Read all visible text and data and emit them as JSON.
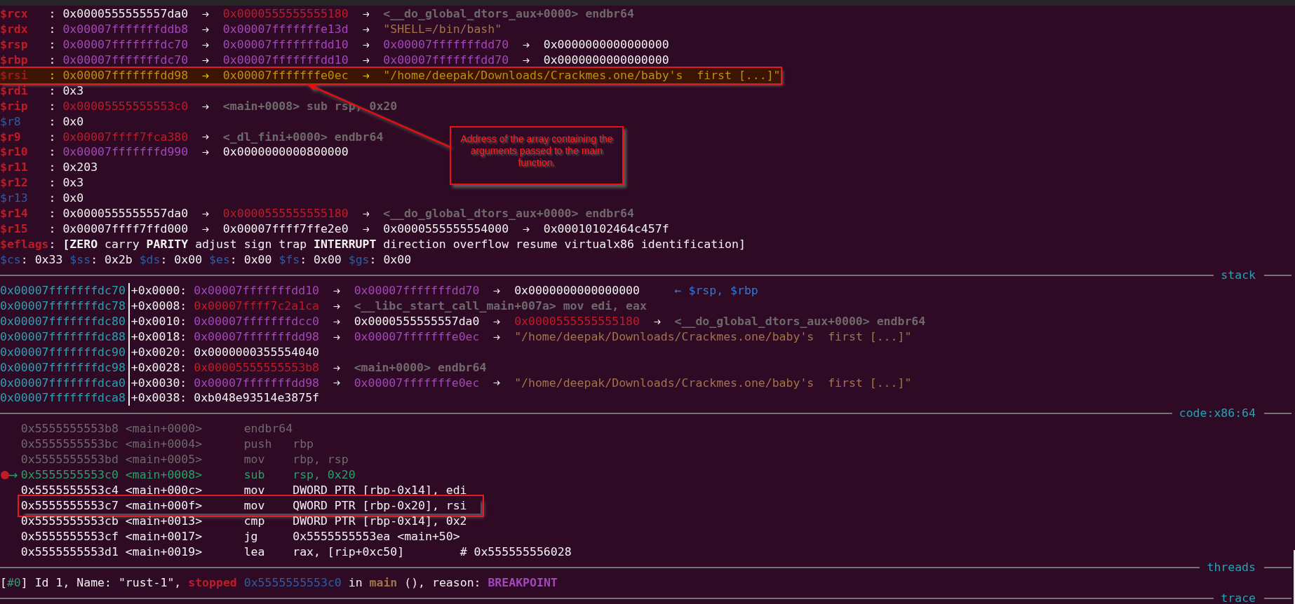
{
  "registers": [
    {
      "name": "$rcx",
      "sep": ":",
      "changed": true,
      "highlighted": false,
      "chain": [
        {
          "text": "0x0000555555557da0",
          "kind": "value"
        },
        {
          "text": "0x0000555555555180",
          "kind": "code"
        },
        {
          "text": "<__do_global_dtors_aux+0000> endbr64",
          "kind": "symbol"
        }
      ]
    },
    {
      "name": "$rdx",
      "sep": ":",
      "changed": true,
      "highlighted": false,
      "chain": [
        {
          "text": "0x00007fffffffddb8",
          "kind": "stack"
        },
        {
          "text": "0x00007fffffffe13d",
          "kind": "stack"
        },
        {
          "text": "\"SHELL=/bin/bash\"",
          "kind": "string"
        }
      ]
    },
    {
      "name": "$rsp",
      "sep": ":",
      "changed": true,
      "highlighted": false,
      "chain": [
        {
          "text": "0x00007fffffffdc70",
          "kind": "stack"
        },
        {
          "text": "0x00007fffffffdd10",
          "kind": "stack"
        },
        {
          "text": "0x00007fffffffdd70",
          "kind": "stack"
        },
        {
          "text": "0x0000000000000000",
          "kind": "value"
        }
      ]
    },
    {
      "name": "$rbp",
      "sep": ":",
      "changed": true,
      "highlighted": false,
      "chain": [
        {
          "text": "0x00007fffffffdc70",
          "kind": "stack"
        },
        {
          "text": "0x00007fffffffdd10",
          "kind": "stack"
        },
        {
          "text": "0x00007fffffffdd70",
          "kind": "stack"
        },
        {
          "text": "0x0000000000000000",
          "kind": "value"
        }
      ]
    },
    {
      "name": "$rsi",
      "sep": ":",
      "changed": true,
      "highlighted": true,
      "chain": [
        {
          "text": "0x00007fffffffdd98",
          "kind": "stack"
        },
        {
          "text": "0x00007fffffffe0ec",
          "kind": "stack"
        },
        {
          "text": "\"/home/deepak/Downloads/Crackmes.one/baby's  first [...]\"",
          "kind": "string"
        }
      ]
    },
    {
      "name": "$rdi",
      "sep": ":",
      "changed": true,
      "highlighted": false,
      "chain": [
        {
          "text": "0x3",
          "kind": "value"
        }
      ]
    },
    {
      "name": "$rip",
      "sep": ":",
      "changed": true,
      "highlighted": false,
      "chain": [
        {
          "text": "0x00005555555553c0",
          "kind": "code"
        },
        {
          "text": "<main+0008> sub rsp, 0x20",
          "kind": "symbol"
        }
      ]
    },
    {
      "name": "$r8",
      "sep": ":",
      "changed": false,
      "highlighted": false,
      "chain": [
        {
          "text": "0x0",
          "kind": "value"
        }
      ]
    },
    {
      "name": "$r9",
      "sep": ":",
      "changed": true,
      "highlighted": false,
      "chain": [
        {
          "text": "0x00007ffff7fca380",
          "kind": "code"
        },
        {
          "text": "<_dl_fini+0000> endbr64",
          "kind": "symbol"
        }
      ]
    },
    {
      "name": "$r10",
      "sep": ":",
      "changed": true,
      "highlighted": false,
      "chain": [
        {
          "text": "0x00007fffffffd990",
          "kind": "stack"
        },
        {
          "text": "0x0000000000800000",
          "kind": "value"
        }
      ]
    },
    {
      "name": "$r11",
      "sep": ":",
      "changed": true,
      "highlighted": false,
      "chain": [
        {
          "text": "0x203",
          "kind": "value"
        }
      ]
    },
    {
      "name": "$r12",
      "sep": ":",
      "changed": true,
      "highlighted": false,
      "chain": [
        {
          "text": "0x3",
          "kind": "value"
        }
      ]
    },
    {
      "name": "$r13",
      "sep": ":",
      "changed": false,
      "highlighted": false,
      "chain": [
        {
          "text": "0x0",
          "kind": "value"
        }
      ]
    },
    {
      "name": "$r14",
      "sep": ":",
      "changed": true,
      "highlighted": false,
      "chain": [
        {
          "text": "0x0000555555557da0",
          "kind": "value"
        },
        {
          "text": "0x0000555555555180",
          "kind": "code"
        },
        {
          "text": "<__do_global_dtors_aux+0000> endbr64",
          "kind": "symbol"
        }
      ]
    },
    {
      "name": "$r15",
      "sep": ":",
      "changed": true,
      "highlighted": false,
      "chain": [
        {
          "text": "0x00007ffff7ffd000",
          "kind": "value"
        },
        {
          "text": "0x00007ffff7ffe2e0",
          "kind": "value"
        },
        {
          "text": "0x0000555555554000",
          "kind": "value"
        },
        {
          "text": "0x00010102464c457f",
          "kind": "value"
        }
      ]
    }
  ],
  "eflags": {
    "name": "$eflags",
    "sep": ":",
    "flags": [
      {
        "text": "[ZERO",
        "set": true
      },
      {
        "text": "carry",
        "set": false
      },
      {
        "text": "PARITY",
        "set": true
      },
      {
        "text": "adjust",
        "set": false
      },
      {
        "text": "sign",
        "set": false
      },
      {
        "text": "trap",
        "set": false
      },
      {
        "text": "INTERRUPT",
        "set": true
      },
      {
        "text": "direction",
        "set": false
      },
      {
        "text": "overflow",
        "set": false
      },
      {
        "text": "resume",
        "set": false
      },
      {
        "text": "virtualx86",
        "set": false
      },
      {
        "text": "identification]",
        "set": false
      }
    ]
  },
  "segments": [
    {
      "name": "$cs",
      "sep": ":",
      "value": "0x33"
    },
    {
      "name": "$ss",
      "sep": ":",
      "value": "0x2b"
    },
    {
      "name": "$ds",
      "sep": ":",
      "value": "0x00"
    },
    {
      "name": "$es",
      "sep": ":",
      "value": "0x00"
    },
    {
      "name": "$fs",
      "sep": ":",
      "value": "0x00"
    },
    {
      "name": "$gs",
      "sep": ":",
      "value": "0x00"
    }
  ],
  "stack": {
    "title": "stack",
    "rows": [
      {
        "address": "0x00007fffffffdc70",
        "offset": "+0x0000:",
        "chain": [
          {
            "text": "0x00007fffffffdd10",
            "kind": "stack"
          },
          {
            "text": "0x00007fffffffdd70",
            "kind": "stack"
          },
          {
            "text": "0x0000000000000000",
            "kind": "value"
          }
        ],
        "note": "← $rsp, $rbp"
      },
      {
        "address": "0x00007fffffffdc78",
        "offset": "+0x0008:",
        "chain": [
          {
            "text": "0x00007ffff7c2a1ca",
            "kind": "code"
          },
          {
            "text": "<__libc_start_call_main+007a> mov edi, eax",
            "kind": "symbol"
          }
        ]
      },
      {
        "address": "0x00007fffffffdc80",
        "offset": "+0x0010:",
        "chain": [
          {
            "text": "0x00007fffffffdcc0",
            "kind": "stack"
          },
          {
            "text": "0x0000555555557da0",
            "kind": "value"
          },
          {
            "text": "0x0000555555555180",
            "kind": "code"
          },
          {
            "text": "<__do_global_dtors_aux+0000> endbr64",
            "kind": "symbol"
          }
        ]
      },
      {
        "address": "0x00007fffffffdc88",
        "offset": "+0x0018:",
        "chain": [
          {
            "text": "0x00007fffffffdd98",
            "kind": "stack"
          },
          {
            "text": "0x00007fffffffe0ec",
            "kind": "stack"
          },
          {
            "text": "\"/home/deepak/Downloads/Crackmes.one/baby's  first [...]\"",
            "kind": "string"
          }
        ]
      },
      {
        "address": "0x00007fffffffdc90",
        "offset": "+0x0020:",
        "chain": [
          {
            "text": "0x0000000355554040",
            "kind": "value"
          }
        ]
      },
      {
        "address": "0x00007fffffffdc98",
        "offset": "+0x0028:",
        "chain": [
          {
            "text": "0x00005555555553b8",
            "kind": "code"
          },
          {
            "text": "<main+0000> endbr64",
            "kind": "symbol"
          }
        ]
      },
      {
        "address": "0x00007fffffffdca0",
        "offset": "+0x0030:",
        "chain": [
          {
            "text": "0x00007fffffffdd98",
            "kind": "stack"
          },
          {
            "text": "0x00007fffffffe0ec",
            "kind": "stack"
          },
          {
            "text": "\"/home/deepak/Downloads/Crackmes.one/baby's  first [...]\"",
            "kind": "string"
          }
        ]
      },
      {
        "address": "0x00007fffffffdca8",
        "offset": "+0x0038:",
        "chain": [
          {
            "text": "0xb048e93514e3875f",
            "kind": "value"
          }
        ]
      }
    ]
  },
  "code": {
    "title": "code:x86:64",
    "lines": [
      {
        "address": "0x5555555553b8",
        "symbol": "<main+0000>",
        "mnemonic": "endbr64",
        "kind": "past",
        "highlighted": false
      },
      {
        "address": "0x5555555553bc",
        "symbol": "<main+0004>",
        "mnemonic": "push",
        "operands": "rbp",
        "kind": "past",
        "highlighted": false
      },
      {
        "address": "0x5555555553bd",
        "symbol": "<main+0005>",
        "mnemonic": "mov",
        "operands": "rbp, rsp",
        "kind": "past",
        "highlighted": false
      },
      {
        "address": "0x5555555553c0",
        "symbol": "<main+0008>",
        "mnemonic": "sub",
        "operands": "rsp, 0x20",
        "kind": "current",
        "highlighted": false
      },
      {
        "address": "0x5555555553c4",
        "symbol": "<main+000c>",
        "mnemonic": "mov",
        "operands": "DWORD PTR [rbp-0x14], edi",
        "kind": "future",
        "highlighted": false
      },
      {
        "address": "0x5555555553c7",
        "symbol": "<main+000f>",
        "mnemonic": "mov",
        "operands": "QWORD PTR [rbp-0x20], rsi",
        "kind": "future",
        "highlighted": true
      },
      {
        "address": "0x5555555553cb",
        "symbol": "<main+0013>",
        "mnemonic": "cmp",
        "operands": "DWORD PTR [rbp-0x14], 0x2",
        "kind": "future",
        "highlighted": false
      },
      {
        "address": "0x5555555553cf",
        "symbol": "<main+0017>",
        "mnemonic": "jg",
        "operands": "0x5555555553ea <main+50>",
        "kind": "future",
        "highlighted": false
      },
      {
        "address": "0x5555555553d1",
        "symbol": "<main+0019>",
        "mnemonic": "lea",
        "operands": "rax, [rip+0xc50]",
        "comment": "# 0x555555556028",
        "kind": "future",
        "highlighted": false
      }
    ]
  },
  "threads": {
    "title": "threads",
    "entries": [
      {
        "parts": [
          {
            "text": "[",
            "kind": "plain"
          },
          {
            "text": "#0",
            "kind": "index"
          },
          {
            "text": "] Id 1, Name: \"rust-1\", ",
            "kind": "plain"
          },
          {
            "text": "stopped",
            "kind": "status"
          },
          {
            "text": "0x5555555553c0",
            "kind": "pc"
          },
          {
            "text": " in ",
            "kind": "plain"
          },
          {
            "text": "main",
            "kind": "function"
          },
          {
            "text": " (), reason: ",
            "kind": "plain"
          },
          {
            "text": "BREAKPOINT",
            "kind": "reason"
          }
        ]
      }
    ]
  },
  "trace": {
    "title": "trace"
  },
  "callout": {
    "text": "Address of the array containing the arguments passed to the main function."
  }
}
